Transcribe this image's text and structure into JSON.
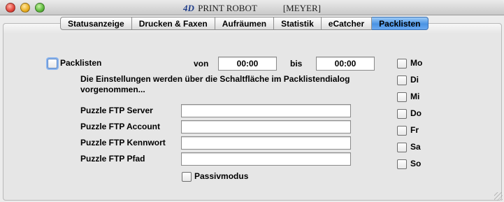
{
  "window": {
    "title_logo": "4D",
    "title": "PRINT ROBOT",
    "user": "[MEYER]"
  },
  "tabs": [
    {
      "label": "Statusanzeige",
      "active": false
    },
    {
      "label": "Drucken & Faxen",
      "active": false
    },
    {
      "label": "Aufräumen",
      "active": false
    },
    {
      "label": "Statistik",
      "active": false
    },
    {
      "label": "eCatcher",
      "active": false
    },
    {
      "label": "Packlisten",
      "active": true
    }
  ],
  "packlisten": {
    "enable_label": "Packlisten",
    "enabled": false,
    "from_label": "von",
    "from_value": "00:00",
    "to_label": "bis",
    "to_value": "00:00",
    "note": "Die Einstellungen werden über die  Schaltfläche im Packlistendialog vorgenommen..."
  },
  "ftp": {
    "server_label": "Puzzle FTP Server",
    "server_value": "",
    "account_label": "Puzzle FTP Account",
    "account_value": "",
    "password_label": "Puzzle FTP Kennwort",
    "password_value": "",
    "path_label": "Puzzle FTP Pfad",
    "path_value": "",
    "passive_label": "Passivmodus",
    "passive": false
  },
  "days": [
    {
      "label": "Mo",
      "checked": false
    },
    {
      "label": "Di",
      "checked": false
    },
    {
      "label": "Mi",
      "checked": false
    },
    {
      "label": "Do",
      "checked": false
    },
    {
      "label": "Fr",
      "checked": false
    },
    {
      "label": "Sa",
      "checked": false
    },
    {
      "label": "So",
      "checked": false
    }
  ],
  "colors": {
    "active_tab": "#4a93e3",
    "focus_ring": "#8ab4ee",
    "window_bg": "#ececec"
  }
}
